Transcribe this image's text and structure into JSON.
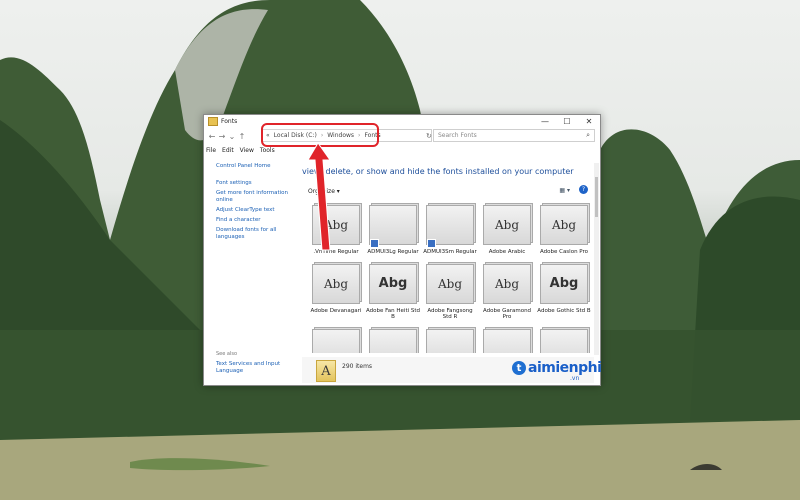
{
  "window": {
    "title": "Fonts",
    "minimize": "—",
    "maximize": "☐",
    "close": "✕"
  },
  "nav": {
    "back": "←",
    "forward": "→",
    "recent": "⌄",
    "up": "↑"
  },
  "address": {
    "prefix": "«",
    "crumbs": [
      "Local Disk (C:)",
      "Windows",
      "Fonts"
    ],
    "separator": "›",
    "refresh": "↻"
  },
  "search": {
    "placeholder": "Search Fonts"
  },
  "menu": [
    "File",
    "Edit",
    "View",
    "Tools"
  ],
  "left_pane": {
    "home": "Control Panel Home",
    "links": [
      "Font settings",
      "Get more font information online",
      "Adjust ClearType text",
      "Find a character",
      "Download fonts for all languages"
    ],
    "see_also_title": "See also",
    "see_also_link": "Text Services and Input Language"
  },
  "content": {
    "heading": "view, delete, or show and hide the fonts installed on your computer",
    "organize": "Organize ▾",
    "view_icon": "▦ ▾",
    "help": "?"
  },
  "fonts": [
    {
      "sample": "Abg",
      "label": ".VnTime Regular",
      "bold": false,
      "badge": false
    },
    {
      "sample": "",
      "label": "ADMUI3Lg Regular",
      "bold": false,
      "badge": true
    },
    {
      "sample": "",
      "label": "ADMUI3Sm Regular",
      "bold": false,
      "badge": true
    },
    {
      "sample": "Abg",
      "label": "Adobe Arabic",
      "bold": false,
      "badge": false
    },
    {
      "sample": "Abg",
      "label": "Adobe Caslon Pro",
      "bold": false,
      "badge": false
    },
    {
      "sample": "Abg",
      "label": "Adobe Devanagari",
      "bold": false,
      "badge": false
    },
    {
      "sample": "Abg",
      "label": "Adobe Fan Heiti Std B",
      "bold": true,
      "badge": false
    },
    {
      "sample": "Abg",
      "label": "Adobe Fangsong Std R",
      "bold": false,
      "badge": false
    },
    {
      "sample": "Abg",
      "label": "Adobe Garamond Pro",
      "bold": false,
      "badge": false
    },
    {
      "sample": "Abg",
      "label": "Adobe Gothic Std B",
      "bold": true,
      "badge": false
    },
    {
      "sample": "",
      "label": "",
      "bold": false,
      "badge": false
    },
    {
      "sample": "",
      "label": "",
      "bold": false,
      "badge": false
    },
    {
      "sample": "",
      "label": "",
      "bold": false,
      "badge": false
    },
    {
      "sample": "",
      "label": "",
      "bold": false,
      "badge": false
    },
    {
      "sample": "",
      "label": "",
      "bold": false,
      "badge": false
    }
  ],
  "status": {
    "icon_letter": "A",
    "count": "290 items"
  },
  "watermark": {
    "logo": "t",
    "text": "aimienphi",
    "suffix": ".vn"
  },
  "colors": {
    "highlight": "#e0242a",
    "link": "#1a5fb4",
    "heading": "#1e4f9b"
  }
}
